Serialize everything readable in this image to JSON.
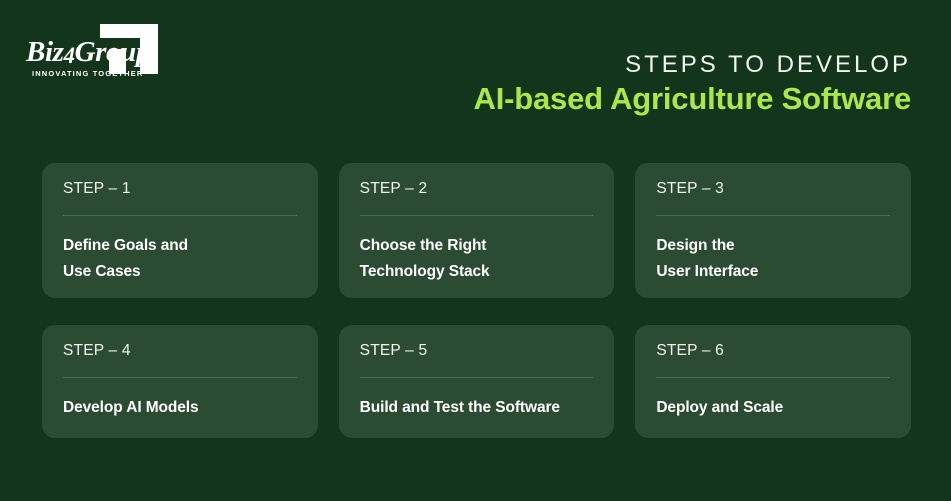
{
  "brand": {
    "logo_wordmark_pre": "Biz",
    "logo_wordmark_num": "4",
    "logo_wordmark_post": "Group",
    "logo_tagline": "INNOVATING TOGETHER",
    "logo_mark_name": "bracket-mark",
    "logo_color": "#FFFFFF"
  },
  "header": {
    "kicker": "STEPS TO DEVELOP",
    "title": "AI-based Agriculture Software",
    "accent_color": "#A9E84D",
    "kicker_color": "#F2F4F1"
  },
  "theme": {
    "page_background": "#13351C",
    "card_background": "#2C4B33",
    "divider_color": "#4E6B53",
    "text_color": "#FFFFFF"
  },
  "steps": [
    {
      "step_label": "STEP – 1",
      "text": "Define Goals and\nUse Cases"
    },
    {
      "step_label": "STEP – 2",
      "text": "Choose the Right\nTechnology Stack"
    },
    {
      "step_label": "STEP – 3",
      "text": "Design the\nUser Interface"
    },
    {
      "step_label": "STEP – 4",
      "text": "Develop AI Models"
    },
    {
      "step_label": "STEP – 5",
      "text": "Build and Test the Software"
    },
    {
      "step_label": "STEP – 6",
      "text": "Deploy and Scale"
    }
  ]
}
